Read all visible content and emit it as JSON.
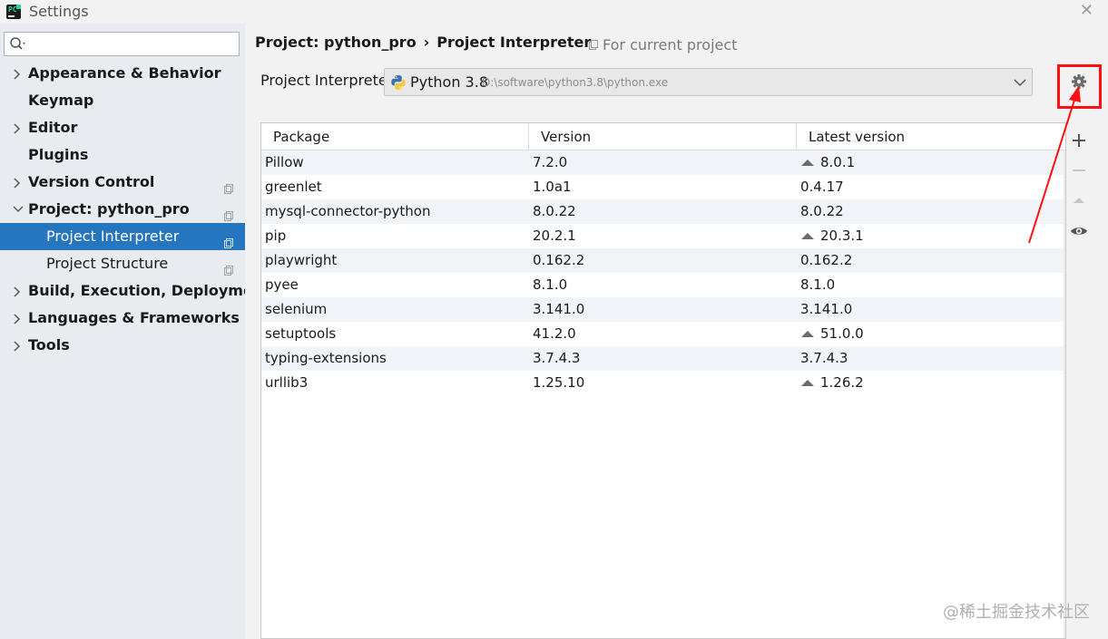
{
  "window": {
    "title": "Settings",
    "app_icon": "pycharm-icon",
    "close_icon": "close-icon"
  },
  "sidebar": {
    "search": {
      "placeholder": "",
      "value": ""
    },
    "items": [
      {
        "label": "Appearance & Behavior",
        "expandable": true,
        "expanded": false
      },
      {
        "label": "Keymap",
        "expandable": false
      },
      {
        "label": "Editor",
        "expandable": true,
        "expanded": false
      },
      {
        "label": "Plugins",
        "expandable": false
      },
      {
        "label": "Version Control",
        "expandable": true,
        "expanded": false,
        "project_scope": true
      },
      {
        "label": "Project: python_pro",
        "expandable": true,
        "expanded": true,
        "project_scope": true
      },
      {
        "label": "Project Interpreter",
        "child": true,
        "selected": true,
        "project_scope": true
      },
      {
        "label": "Project Structure",
        "child": true,
        "project_scope": true
      },
      {
        "label": "Build, Execution, Deployment",
        "expandable": true,
        "expanded": false
      },
      {
        "label": "Languages & Frameworks",
        "expandable": true,
        "expanded": false
      },
      {
        "label": "Tools",
        "expandable": true,
        "expanded": false
      }
    ]
  },
  "header": {
    "breadcrumb_parent": "Project: python_pro",
    "breadcrumb_sep": "›",
    "breadcrumb_current": "Project Interpreter",
    "scope_note": "For current project"
  },
  "interpreter": {
    "label": "Project Interpreter:",
    "name": "Python 3.8",
    "path": "D:\\software\\python3.8\\python.exe"
  },
  "packages": {
    "columns": [
      "Package",
      "Version",
      "Latest version"
    ],
    "rows": [
      {
        "package": "Pillow",
        "version": "7.2.0",
        "latest": "8.0.1",
        "upgrade": true
      },
      {
        "package": "greenlet",
        "version": "1.0a1",
        "latest": "0.4.17",
        "upgrade": false
      },
      {
        "package": "mysql-connector-python",
        "version": "8.0.22",
        "latest": "8.0.22",
        "upgrade": false
      },
      {
        "package": "pip",
        "version": "20.2.1",
        "latest": "20.3.1",
        "upgrade": true
      },
      {
        "package": "playwright",
        "version": "0.162.2",
        "latest": "0.162.2",
        "upgrade": false
      },
      {
        "package": "pyee",
        "version": "8.1.0",
        "latest": "8.1.0",
        "upgrade": false
      },
      {
        "package": "selenium",
        "version": "3.141.0",
        "latest": "3.141.0",
        "upgrade": false
      },
      {
        "package": "setuptools",
        "version": "41.2.0",
        "latest": "51.0.0",
        "upgrade": true
      },
      {
        "package": "typing-extensions",
        "version": "3.7.4.3",
        "latest": "3.7.4.3",
        "upgrade": false
      },
      {
        "package": "urllib3",
        "version": "1.25.10",
        "latest": "1.26.2",
        "upgrade": true
      }
    ]
  },
  "toolbar": {
    "settings_icon": "gear-icon",
    "add_icon": "plus-icon",
    "remove_icon": "minus-icon",
    "upgrade_icon": "upgrade-arrow-icon",
    "show_early_icon": "eye-icon"
  },
  "annotation": {
    "highlight_color": "#ff1010"
  },
  "watermark": "@稀土掘金技术社区",
  "colors": {
    "selection": "#2675bf",
    "sidebar_bg": "#e8ebef",
    "row_alt": "#f0f3f8"
  }
}
